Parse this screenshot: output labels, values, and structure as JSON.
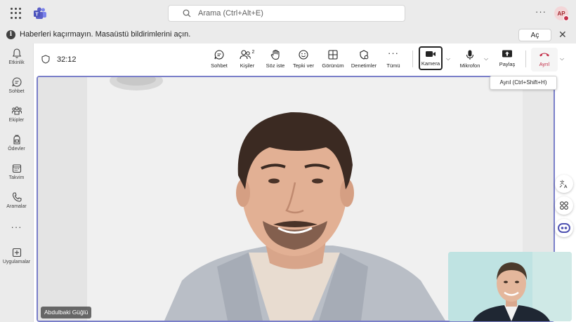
{
  "search": {
    "placeholder": "Arama (Ctrl+Alt+E)"
  },
  "top": {
    "more": "···",
    "avatar_initials": "AP"
  },
  "notification": {
    "message": "Haberleri kaçırmayın. Masaüstü bildirimlerini açın.",
    "open_label": "Aç",
    "close_symbol": "✕"
  },
  "rail": {
    "items": [
      {
        "label": "Etkinlik",
        "icon": "bell-icon"
      },
      {
        "label": "Sohbet",
        "icon": "chat-icon"
      },
      {
        "label": "Ekipler",
        "icon": "teams-icon"
      },
      {
        "label": "Ödevler",
        "icon": "backpack-icon"
      },
      {
        "label": "Takvim",
        "icon": "calendar-icon"
      },
      {
        "label": "Aramalar",
        "icon": "phone-icon"
      }
    ],
    "more": "···",
    "apps_label": "Uygulamalar"
  },
  "meeting": {
    "timer": "32:12",
    "toolbar": {
      "chat": "Sohbet",
      "people": "Kişiler",
      "people_count": "2",
      "raise_hand": "Söz iste",
      "react": "Tepki ver",
      "view": "Görünüm",
      "controls": "Denetimler",
      "more": "Tümü",
      "more_symbol": "···",
      "camera": "Kamera",
      "mic": "Mikrofon",
      "share": "Paylaş",
      "leave": "Ayrıl"
    },
    "leave_tooltip": "Ayrıl (Ctrl+Shift+H)",
    "participant_name": "Abdulbaki Güğlü"
  },
  "colors": {
    "accent": "#7a7fc9",
    "leave": "#c4314b",
    "teams_purple": "#5b5fc7"
  }
}
